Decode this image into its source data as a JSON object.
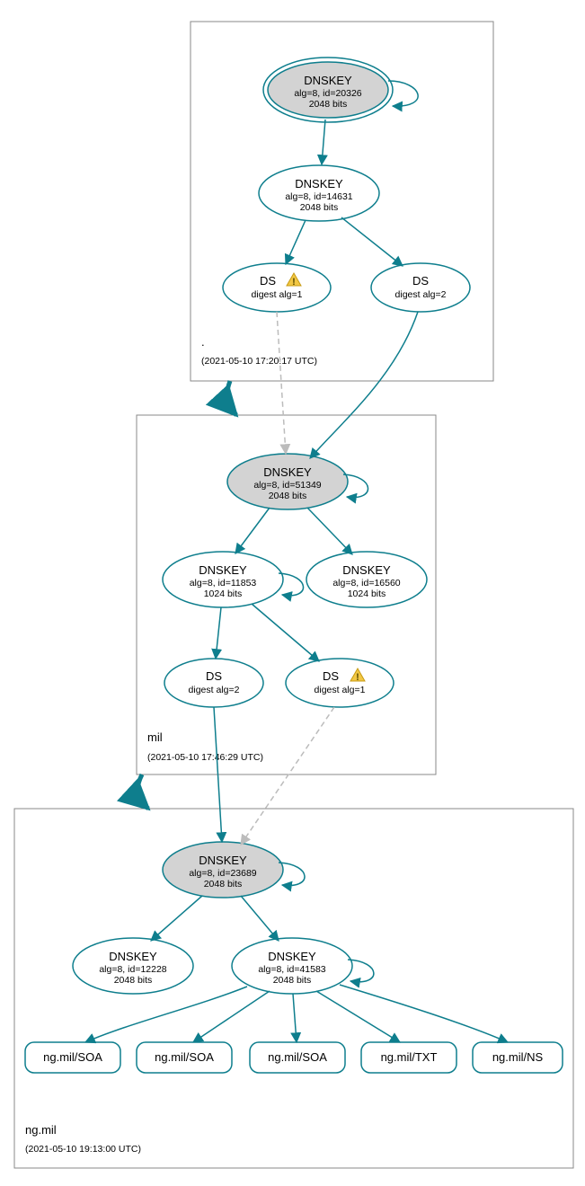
{
  "zones": {
    "root": {
      "label": ".",
      "timestamp": "(2021-05-10 17:20:17 UTC)"
    },
    "mil": {
      "label": "mil",
      "timestamp": "(2021-05-10 17:46:29 UTC)"
    },
    "ngmil": {
      "label": "ng.mil",
      "timestamp": "(2021-05-10 19:13:00 UTC)"
    }
  },
  "nodes": {
    "root_ksk": {
      "title": "DNSKEY",
      "l2": "alg=8, id=20326",
      "l3": "2048 bits"
    },
    "root_zsk": {
      "title": "DNSKEY",
      "l2": "alg=8, id=14631",
      "l3": "2048 bits"
    },
    "root_ds1": {
      "title": "DS",
      "l2": "digest alg=1"
    },
    "root_ds2": {
      "title": "DS",
      "l2": "digest alg=2"
    },
    "mil_ksk": {
      "title": "DNSKEY",
      "l2": "alg=8, id=51349",
      "l3": "2048 bits"
    },
    "mil_zsk1": {
      "title": "DNSKEY",
      "l2": "alg=8, id=11853",
      "l3": "1024 bits"
    },
    "mil_zsk2": {
      "title": "DNSKEY",
      "l2": "alg=8, id=16560",
      "l3": "1024 bits"
    },
    "mil_ds2": {
      "title": "DS",
      "l2": "digest alg=2"
    },
    "mil_ds1": {
      "title": "DS",
      "l2": "digest alg=1"
    },
    "ng_ksk": {
      "title": "DNSKEY",
      "l2": "alg=8, id=23689",
      "l3": "2048 bits"
    },
    "ng_zsk1": {
      "title": "DNSKEY",
      "l2": "alg=8, id=12228",
      "l3": "2048 bits"
    },
    "ng_zsk2": {
      "title": "DNSKEY",
      "l2": "alg=8, id=41583",
      "l3": "2048 bits"
    }
  },
  "rr": {
    "r1": "ng.mil/SOA",
    "r2": "ng.mil/SOA",
    "r3": "ng.mil/SOA",
    "r4": "ng.mil/TXT",
    "r5": "ng.mil/NS"
  }
}
